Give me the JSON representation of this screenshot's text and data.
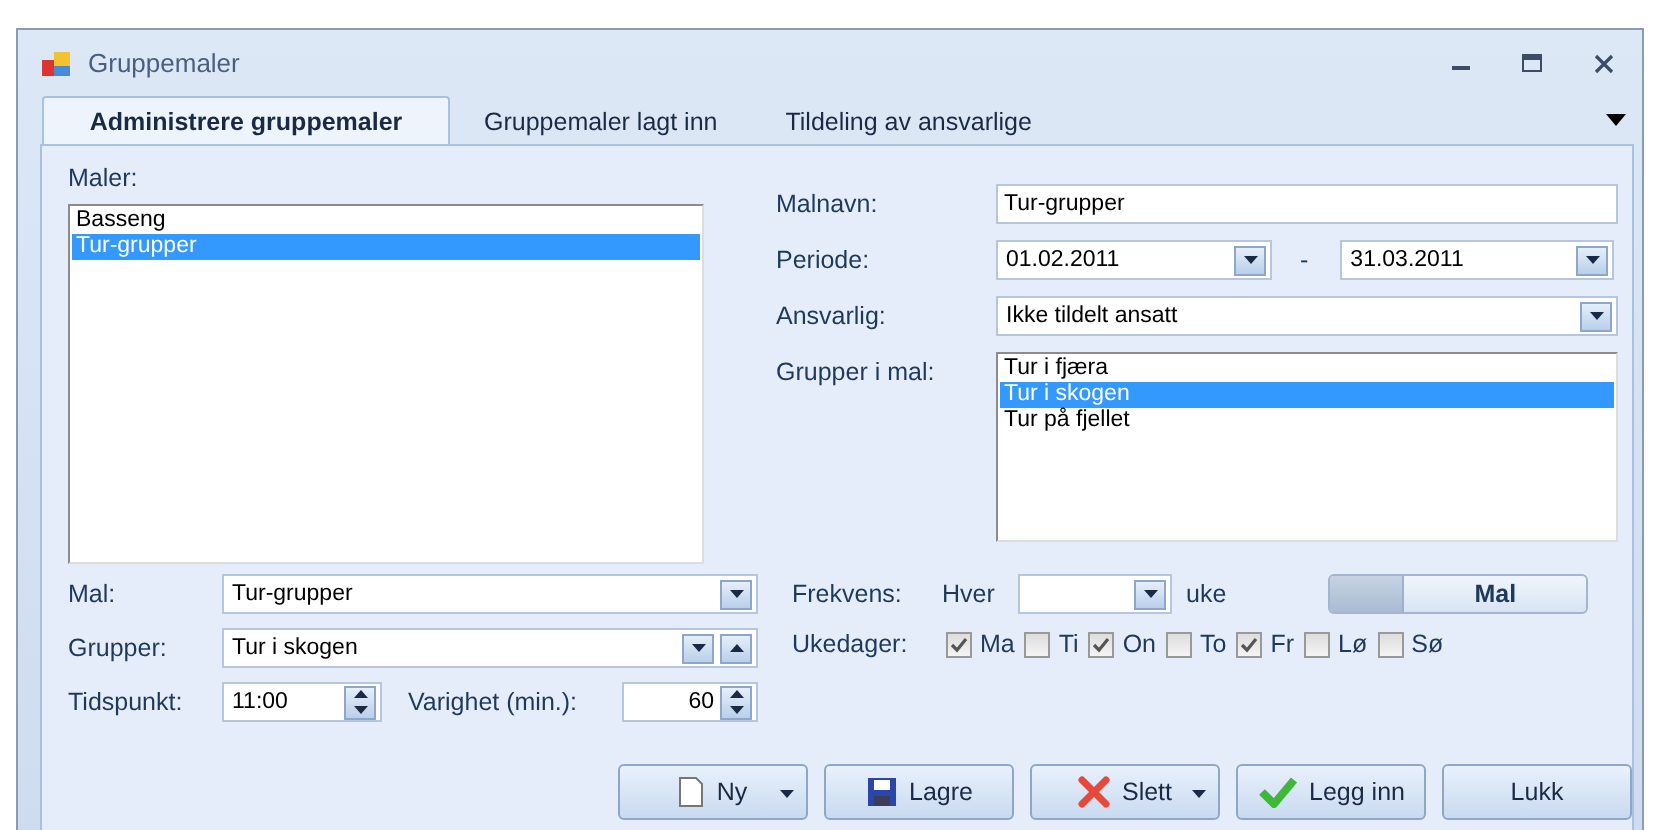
{
  "window": {
    "title": "Gruppemaler"
  },
  "tabs": [
    {
      "label": "Administrere gruppemaler",
      "selected": true
    },
    {
      "label": "Gruppemaler lagt inn",
      "selected": false
    },
    {
      "label": "Tildeling av ansvarlige",
      "selected": false
    }
  ],
  "templates": {
    "label": "Maler:",
    "items": [
      {
        "label": "Basseng",
        "selected": false
      },
      {
        "label": "Tur-grupper",
        "selected": true
      }
    ]
  },
  "details": {
    "name": {
      "label": "Malnavn:",
      "value": "Tur-grupper"
    },
    "period": {
      "label": "Periode:",
      "from": "01.02.2011",
      "separator": "-",
      "to": "31.03.2011"
    },
    "responsible": {
      "label": "Ansvarlig:",
      "value": "Ikke tildelt ansatt"
    },
    "groups": {
      "label": "Grupper i mal:",
      "items": [
        {
          "label": "Tur i fjæra",
          "selected": false
        },
        {
          "label": "Tur i skogen",
          "selected": true
        },
        {
          "label": "Tur på fjellet",
          "selected": false
        }
      ]
    }
  },
  "schedule": {
    "template": {
      "label": "Mal:",
      "value": "Tur-grupper"
    },
    "group": {
      "label": "Grupper:",
      "value": "Tur i skogen"
    },
    "time": {
      "label": "Tidspunkt:",
      "value": "11:00"
    },
    "duration": {
      "label": "Varighet (min.):",
      "value": "60"
    },
    "frequency": {
      "label": "Frekvens:",
      "prefix": "Hver",
      "suffix": "uke"
    },
    "toggle": {
      "label": "Mal",
      "on": false
    },
    "weekdays": {
      "label": "Ukedager:",
      "days": [
        {
          "label": "Ma",
          "checked": true
        },
        {
          "label": "Ti",
          "checked": false
        },
        {
          "label": "On",
          "checked": true
        },
        {
          "label": "To",
          "checked": false
        },
        {
          "label": "Fr",
          "checked": true
        },
        {
          "label": "Lø",
          "checked": false
        },
        {
          "label": "Sø",
          "checked": false
        }
      ]
    }
  },
  "buttons": [
    {
      "label": "Ny",
      "kind": "new",
      "menu": true
    },
    {
      "label": "Lagre",
      "kind": "save",
      "menu": false
    },
    {
      "label": "Slett",
      "kind": "delete",
      "menu": true
    },
    {
      "label": "Legg inn",
      "kind": "add",
      "menu": false
    },
    {
      "label": "Lukk",
      "kind": "close",
      "menu": false
    }
  ]
}
